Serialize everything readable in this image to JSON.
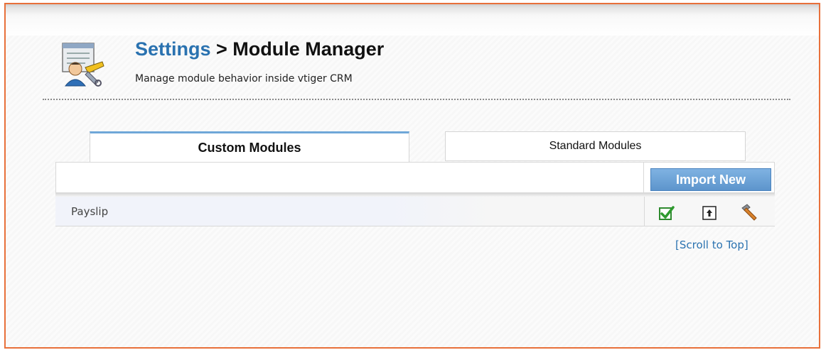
{
  "header": {
    "breadcrumb_link": "Settings",
    "breadcrumb_separator": " > ",
    "title": "Module Manager",
    "subtitle": "Manage module behavior inside vtiger CRM"
  },
  "tabs": [
    {
      "label": "Custom Modules",
      "selected": true
    },
    {
      "label": "Standard Modules",
      "selected": false
    }
  ],
  "toolbar": {
    "import_label": "Import New"
  },
  "modules": [
    {
      "name": "Payslip",
      "enabled": true,
      "actions": [
        "checkbox-enabled-icon",
        "upload-update-icon",
        "hammer-settings-icon"
      ]
    }
  ],
  "footer": {
    "scroll_top_label": "[Scroll to Top]"
  },
  "colors": {
    "frame_border": "#e8703a",
    "link_blue": "#2a72b0",
    "button_blue": "#6fa3d7",
    "tab_accent": "#6fa7d8",
    "check_green": "#2e9a2e"
  }
}
